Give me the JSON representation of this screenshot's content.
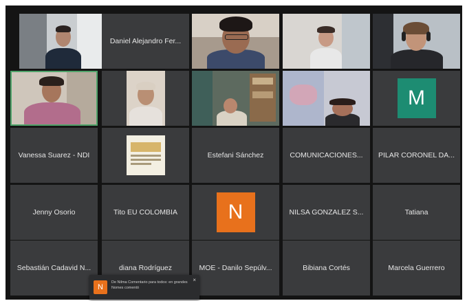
{
  "colors": {
    "background": "#141414",
    "tile": "#3a3b3d",
    "active_border": "#4fa36a",
    "avatar_green": "#1d8c72",
    "avatar_orange": "#e8711c"
  },
  "participants": {
    "r1c2": "Daniel Alejandro Fer...",
    "r3c1": "Vanessa Suarez - NDI",
    "r3c3": "Estefani Sánchez",
    "r3c4": "COMUNICACIONES...",
    "r3c5": "PILAR CORONEL DA...",
    "r4c1": "Jenny Osorio",
    "r4c2": "Tito EU COLOMBIA",
    "r4c4": "NILSA GONZALEZ S...",
    "r4c5": "Tatiana",
    "r5c1": "Sebastián Cadavid N...",
    "r5c2": "diana Rodríguez",
    "r5c3": "MOE - Danilo Sepúlv...",
    "r5c4": "Bibiana Cortés",
    "r5c5": "Marcela Guerrero"
  },
  "avatars": {
    "m": "M",
    "n": "N"
  },
  "toast": {
    "icon_letter": "N",
    "message": "De Nilma Comentario para todos: en grandes Nomes comentó",
    "close": "×"
  }
}
